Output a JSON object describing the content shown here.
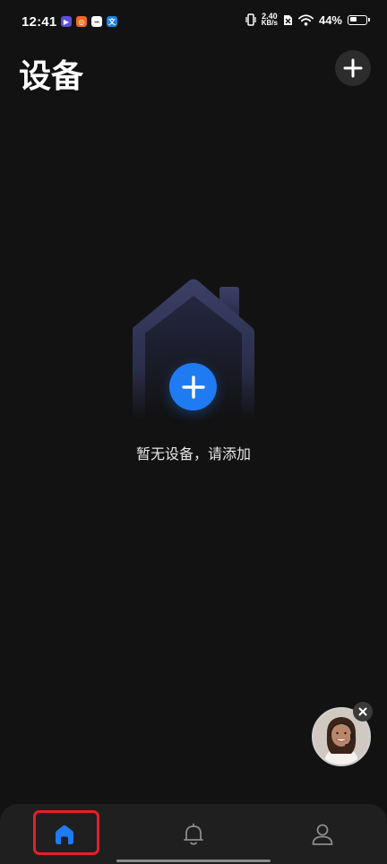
{
  "status_bar": {
    "time": "12:41",
    "net_speed_value": "2.40",
    "net_speed_unit": "KB/s",
    "battery_percent": "44%",
    "battery_level": 0.44,
    "app_icons": [
      "video-app-icon",
      "orange-app-icon",
      "cloud-app-icon",
      "translate-app-icon"
    ]
  },
  "header": {
    "title": "设备",
    "add_icon": "plus-icon"
  },
  "empty_state": {
    "illustration_icon": "house-icon",
    "add_icon": "plus-icon",
    "message": "暂无设备，请添加"
  },
  "floating_assistant": {
    "avatar": "assistant-avatar",
    "close_icon": "close-icon"
  },
  "bottom_nav": {
    "active_index": 0,
    "items": [
      {
        "name": "home",
        "icon": "home-icon"
      },
      {
        "name": "notifications",
        "icon": "bell-icon"
      },
      {
        "name": "profile",
        "icon": "person-icon"
      }
    ]
  },
  "colors": {
    "background": "#121212",
    "accent": "#1f7bf2",
    "nav_background": "#1f1f1f",
    "highlight": "#e2202a"
  }
}
